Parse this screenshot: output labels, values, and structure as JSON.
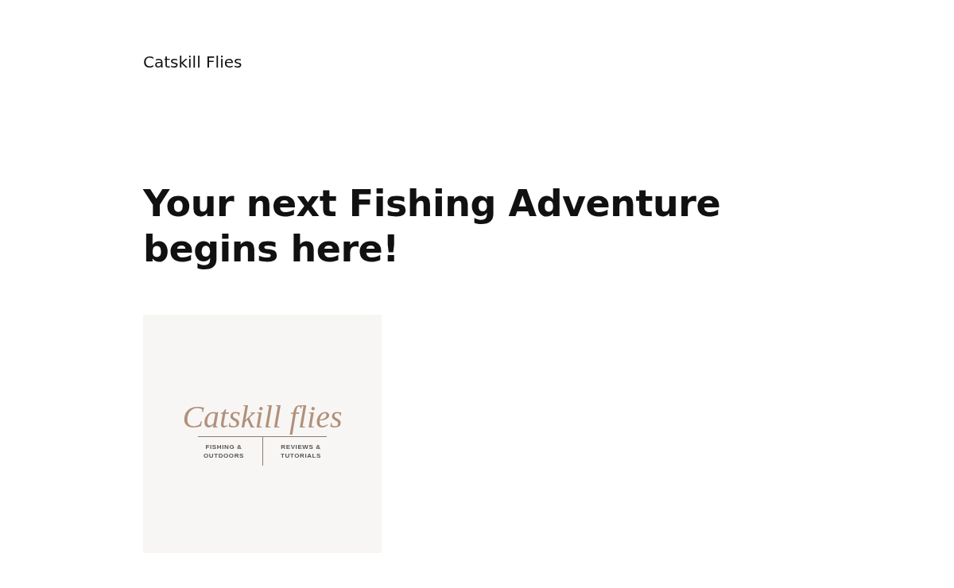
{
  "site_title": "Catskill Flies",
  "heading": "Your next Fishing Adventure begins here!",
  "logo": {
    "name": "Catskill flies",
    "left_tagline": [
      "FISHING &",
      "OUTDOORS"
    ],
    "right_tagline": [
      "REVIEWS &",
      "TUTORIALS"
    ]
  }
}
